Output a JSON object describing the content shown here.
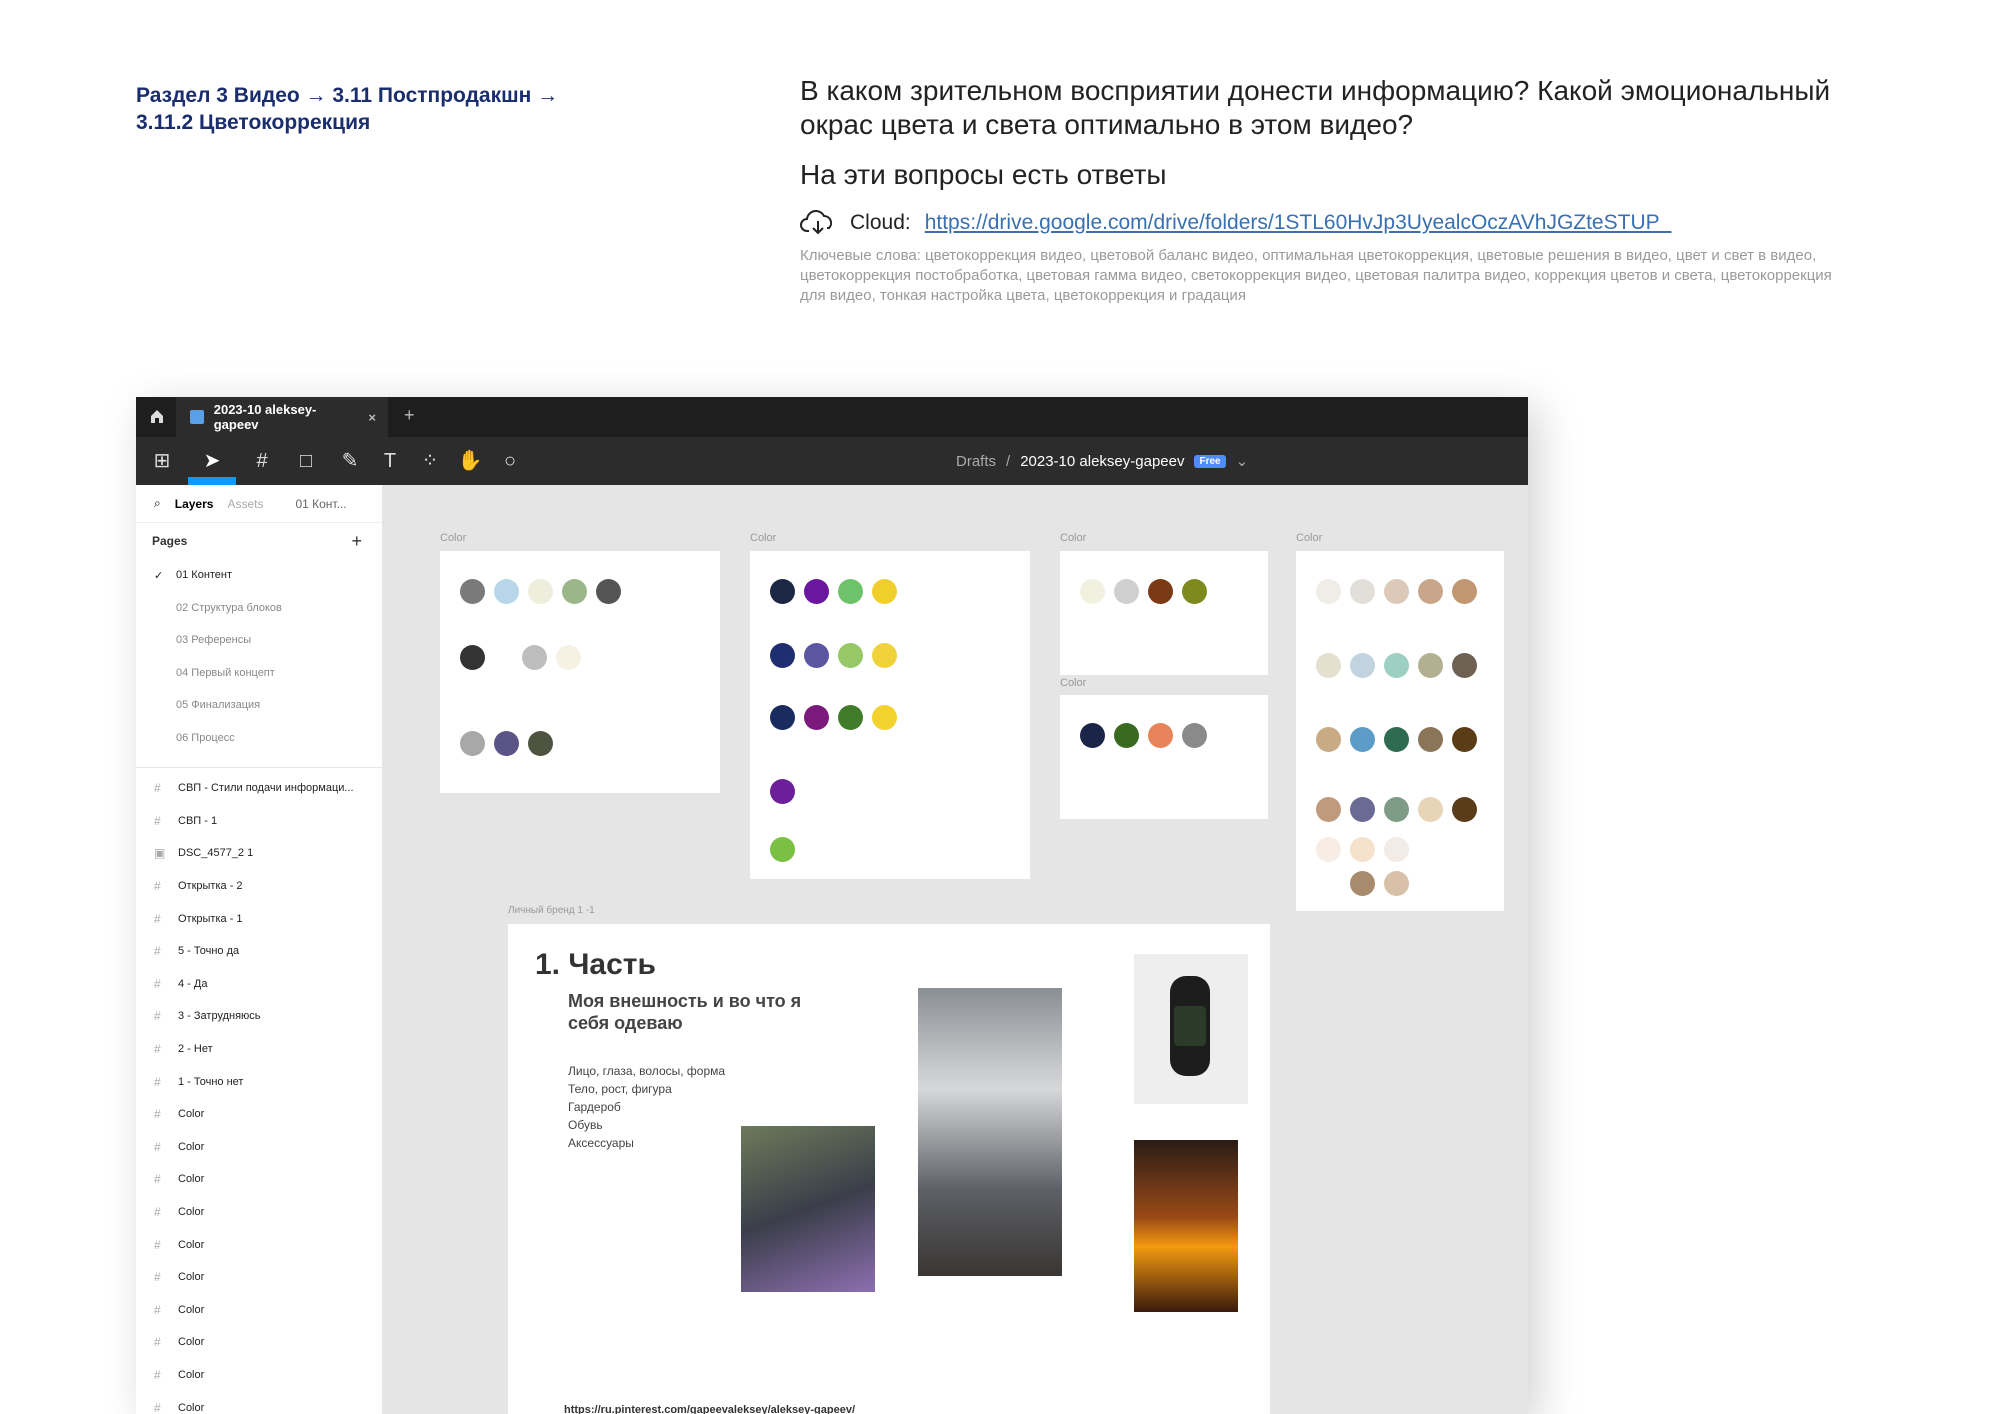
{
  "header": {
    "breadcrumb_line1": "Раздел 3 Видео  → 3.11 Постпродакшн →",
    "breadcrumb_line2": "3.11.2 Цветокоррекция",
    "question": "В каком зрительном восприятии донести информацию? Какой эмоциональный окрас цвета и света оптимально в этом видео?",
    "answer": "На эти вопросы есть ответы",
    "cloud_label": "Cloud:",
    "cloud_link": "https://drive.google.com/drive/folders/1STL60HvJp3UyealcOczAVhJGZteSTUP_",
    "keywords": "Ключевые слова: цветокоррекция видео, цветовой баланс видео, оптимальная цветокоррекция, цветовые решения в видео, цвет и свет в видео, цветокоррекция постобработка, цветовая гамма видео, светокоррекция видео, цветовая палитра видео, коррекция цветов и света, цветокоррекция для видео, тонкая настройка цвета, цветокоррекция и градация"
  },
  "app": {
    "tab_title": "2023-10 aleksey-gapeev",
    "tab_close": "×",
    "tab_add": "+",
    "breadcrumb_drafts": "Drafts",
    "breadcrumb_sep": "/",
    "file_name": "2023-10 aleksey-gapeev",
    "plan_badge": "Free",
    "toolbar_icons": [
      "figma-menu-icon",
      "move-tool-icon",
      "frame-tool-icon",
      "shape-tool-icon",
      "pen-tool-icon",
      "text-tool-icon",
      "components-icon",
      "hand-tool-icon",
      "comment-icon"
    ]
  },
  "sidebar": {
    "tab_layers": "Layers",
    "tab_assets": "Assets",
    "page_dropdown": "01 Конт...",
    "pages_title": "Pages",
    "add_page": "+",
    "pages": [
      "01 Контент",
      "02 Структура блоков",
      "03 Референсы",
      "04 Первый концепт",
      "05 Финализация",
      "06 Процесс"
    ],
    "layers": [
      "СВП - Стили подачи информаци...",
      "СВП - 1",
      "DSC_4577_2 1",
      "Открытка - 2",
      "Открытка - 1",
      "5 - Точно да",
      "4 - Да",
      "3 - Затрудняюсь",
      "2 - Нет",
      "1 - Точно нет",
      "Color",
      "Color",
      "Color",
      "Color",
      "Color",
      "Color",
      "Color",
      "Color",
      "Color",
      "Color"
    ]
  },
  "canvas": {
    "frame_labels": [
      "Color",
      "Color",
      "Color",
      "Color",
      "Color"
    ],
    "palette_colors": [
      "#7a7a7a",
      "#b7d6ea",
      "#eeeedd",
      "#9bb78a",
      "#555555",
      "#333333",
      "#bdbdbd",
      "#f5f2e4",
      "#a8a8a8",
      "#5a5487",
      "#4e5440",
      "#1b2745",
      "#6a169e",
      "#6dc26a",
      "#f0cf2c",
      "#1f2e70",
      "#5a57a0",
      "#96c868",
      "#f0d33a",
      "#1a2b60",
      "#7b1a7c",
      "#417c2a",
      "#f3d22d",
      "#6d1f9a",
      "#7ac143",
      "#f1f1e0",
      "#cfcfcf",
      "#7a3a14",
      "#7f8a1e",
      "#1b2547",
      "#3a6a20",
      "#e8845a",
      "#8a8a8a",
      "#f0ece8",
      "#e2dfd8",
      "#dcc9b8",
      "#c7a68a",
      "#c29772",
      "#e3e0cf",
      "#c0d3de",
      "#9dcfc2",
      "#b3b092",
      "#6e6053",
      "#c8aa85",
      "#5e9cc8",
      "#2e6b51",
      "#8a7558",
      "#5a3d17",
      "#c09a7c",
      "#6a6a95",
      "#7d9b85",
      "#e8d4b7",
      "#5a3c1a",
      "#f7ede4",
      "#f6e2cc",
      "#f3ebe5",
      "#a78b6c",
      "#d8c1a8"
    ],
    "doc_frame_label": "Личный бренд 1 -1",
    "doc_title": "1. Часть",
    "doc_subtitle": "Моя внешность и во что я себя одеваю",
    "doc_list": [
      "Лицо, глаза, волосы, форма",
      "Тело, рост, фигура",
      "Гардероб",
      "Обувь",
      "Аксессуары"
    ],
    "doc_url": "https://ru.pinterest.com/gapeevaleksey/aleksey-gapeev/"
  }
}
